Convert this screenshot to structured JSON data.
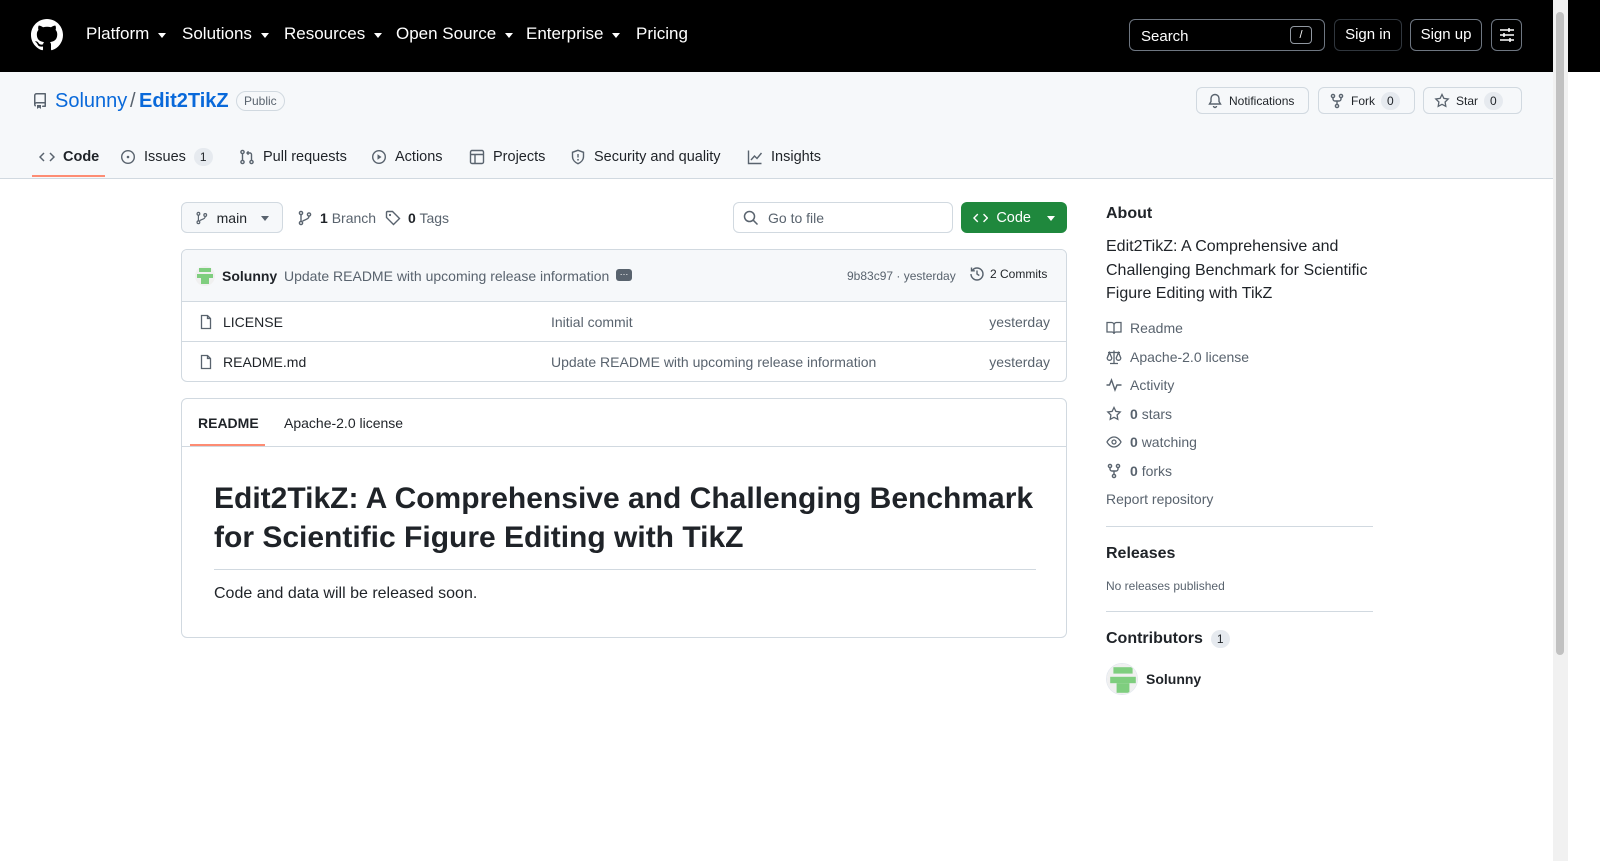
{
  "nav": {
    "items": [
      "Platform",
      "Solutions",
      "Resources",
      "Open Source",
      "Enterprise",
      "Pricing"
    ],
    "search_label": "Search",
    "search_key": "/",
    "signin": "Sign in",
    "signup": "Sign up"
  },
  "repo": {
    "owner": "Solunny",
    "separator": "/",
    "name": "Edit2TikZ",
    "visibility": "Public",
    "notifications": "Notifications",
    "fork_label": "Fork",
    "fork_count": "0",
    "star_label": "Star",
    "star_count": "0"
  },
  "tabs": {
    "code": "Code",
    "issues": "Issues",
    "issues_count": "1",
    "pulls": "Pull requests",
    "actions": "Actions",
    "projects": "Projects",
    "security": "Security and quality",
    "insights": "Insights"
  },
  "toolbar": {
    "branch": "main",
    "branch_count": "1",
    "branch_label": "Branch",
    "tag_count": "0",
    "tag_label": "Tags",
    "goto_placeholder": "Go to file",
    "code_button": "Code"
  },
  "commit": {
    "author": "Solunny",
    "message": "Update README with upcoming release information",
    "hash": "9b83c97 · yesterday",
    "commits": "2 Commits"
  },
  "files": [
    {
      "name": "LICENSE",
      "message": "Initial commit",
      "date": "yesterday"
    },
    {
      "name": "README.md",
      "message": "Update README with upcoming release information",
      "date": "yesterday"
    }
  ],
  "readme": {
    "tab_readme": "README",
    "tab_license": "Apache-2.0 license",
    "title": "Edit2TikZ: A Comprehensive and Challenging Benchmark for Scientific Figure Editing with TikZ",
    "body": "Code and data will be released soon."
  },
  "about": {
    "heading": "About",
    "description": "Edit2TikZ: A Comprehensive and Challenging Benchmark for Scientific Figure Editing with TikZ",
    "readme": "Readme",
    "license": "Apache-2.0 license",
    "activity": "Activity",
    "stars_count": "0",
    "stars_label": "stars",
    "watching_count": "0",
    "watching_label": "watching",
    "forks_count": "0",
    "forks_label": "forks",
    "report": "Report repository"
  },
  "releases": {
    "heading": "Releases",
    "empty": "No releases published"
  },
  "contributors": {
    "heading": "Contributors",
    "count": "1",
    "name": "Solunny"
  },
  "colors": {
    "header_bg": "#000000",
    "link": "#0969da",
    "code_button": "#1f883d",
    "tab_underline": "#fd8c73"
  }
}
